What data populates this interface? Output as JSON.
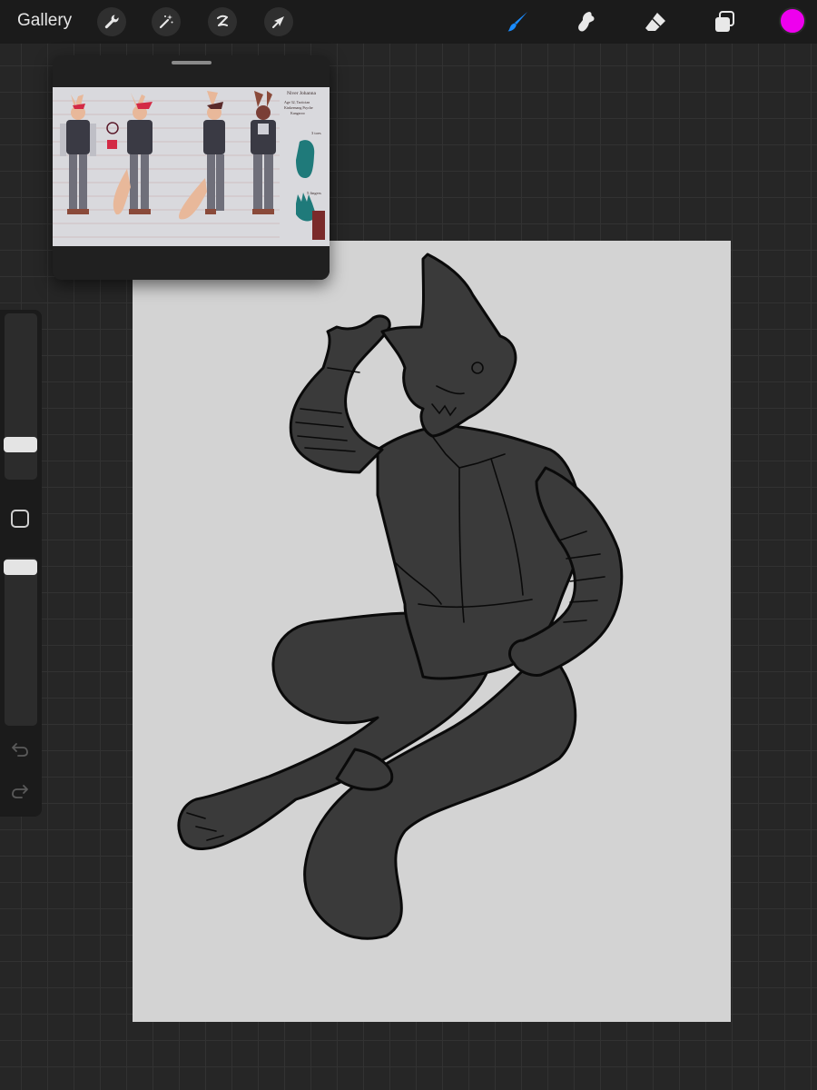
{
  "topbar": {
    "gallery_label": "Gallery",
    "left_tools": [
      "wrench-icon",
      "magic-wand-icon",
      "selection-icon",
      "transform-arrow-icon"
    ],
    "right_tools": [
      "brush-icon",
      "smudge-icon",
      "eraser-icon",
      "layers-icon"
    ],
    "active_tool": "brush",
    "active_tool_color": "#1a8cff",
    "current_color": "#ee00ee"
  },
  "sidebar": {
    "brush_size_level": 0.45,
    "opacity_level": 0.15,
    "modifier_icon": "square-modifier-icon",
    "undo_icon": "undo-icon",
    "redo_icon": "redo-icon"
  },
  "reference": {
    "sheet_text": {
      "name": "Niver Johanna",
      "line1": "Age 32, Tactician",
      "line2": "Kinkeenang Psyche",
      "line3": "Kangaroo",
      "toes_label": "3 toes",
      "fingers_label": "5 fingers"
    }
  },
  "canvas": {
    "background": "#d3d3d3",
    "figure_fill": "#3a3a3a"
  }
}
